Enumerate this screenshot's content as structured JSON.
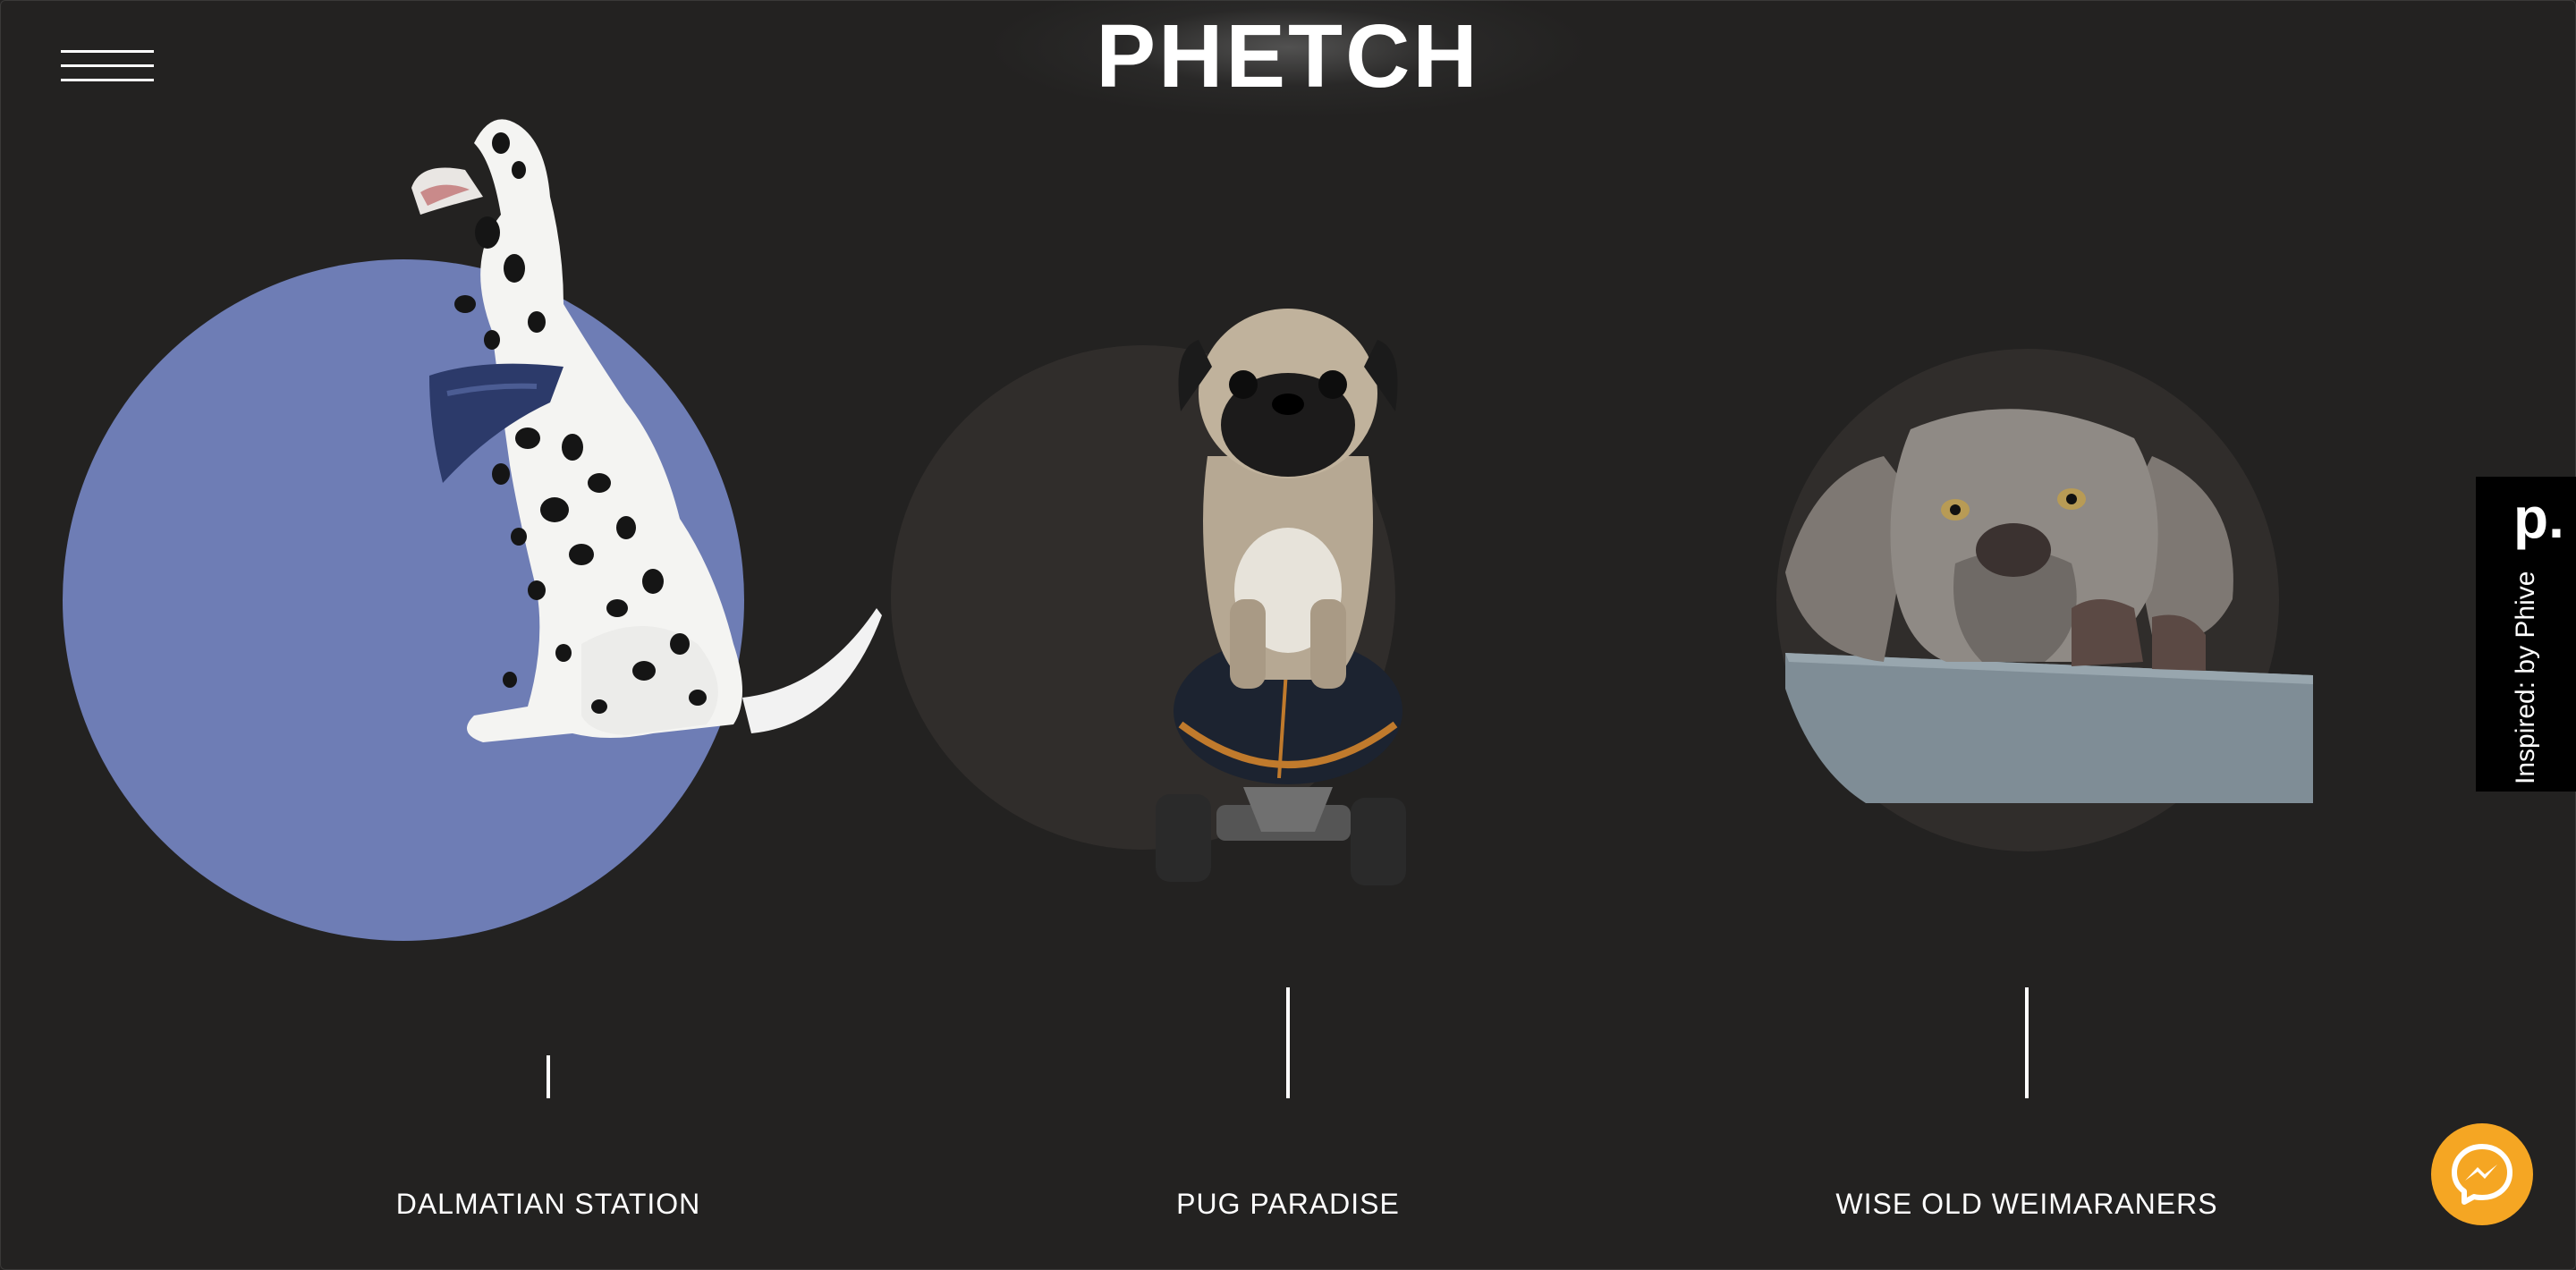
{
  "header": {
    "brand": "PHETCH"
  },
  "sections": [
    {
      "title": "DALMATIAN STATION",
      "circle_color": "#6e7db5"
    },
    {
      "title": "PUG PARADISE",
      "circle_color": "#302d2b"
    },
    {
      "title": "WISE OLD WEIMARANERS",
      "circle_color": "#302d2b"
    }
  ],
  "side_tab": {
    "logo": "p.",
    "text": "Inspired: by Phive"
  },
  "colors": {
    "background": "#232221",
    "accent": "#f5a623",
    "text": "#ffffff"
  },
  "icons": {
    "menu": "hamburger-icon",
    "chat": "messenger-icon"
  }
}
